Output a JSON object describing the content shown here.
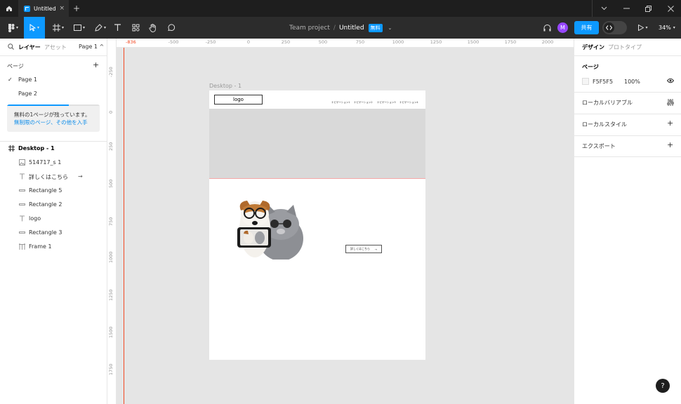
{
  "titlebar": {
    "tab_title": "Untitled",
    "tab_close": "×",
    "new_tab": "+"
  },
  "toolbar": {
    "breadcrumb_team": "Team project",
    "breadcrumb_sep": "/",
    "file_name": "Untitled",
    "plan_badge": "無料",
    "avatar_letter": "M",
    "share_label": "共有",
    "zoom_level": "34%"
  },
  "left_panel": {
    "tab_layers": "レイヤー",
    "tab_assets": "アセット",
    "page_selector": "Page 1 ^",
    "pages_title": "ページ",
    "pages": [
      "Page 1",
      "Page 2"
    ],
    "notice_line1": "無料の1ページが残っています。",
    "notice_line2": "無制限のページ、その他を入手",
    "notice_progress": 0.67,
    "layers": [
      {
        "name": "Desktop - 1",
        "icon": "frame-hash-icon"
      },
      {
        "name": "514717_s 1",
        "icon": "image-icon"
      },
      {
        "name": "詳しくはこちら",
        "icon": "text-icon",
        "trailing": "→"
      },
      {
        "name": "Rectangle 5",
        "icon": "rectangle-line-icon"
      },
      {
        "name": "Rectangle 2",
        "icon": "rectangle-line-icon"
      },
      {
        "name": "logo",
        "icon": "text-icon"
      },
      {
        "name": "Rectangle 3",
        "icon": "rectangle-line-icon"
      },
      {
        "name": "Frame 1",
        "icon": "frame-columns-icon"
      }
    ]
  },
  "canvas": {
    "ruler_x": [
      "-836",
      "-500",
      "-250",
      "0",
      "250",
      "500",
      "750",
      "1000",
      "1250",
      "1500",
      "1750",
      "2000"
    ],
    "ruler_y": [
      "-250",
      "0",
      "250",
      "500",
      "750",
      "1000",
      "1250",
      "1500",
      "1750"
    ],
    "frame_label": "Desktop - 1",
    "artboard": {
      "logo": "logo",
      "nav": [
        "ナビゲーション1",
        "ナビゲーション2",
        "ナビゲーション3",
        "ナビゲーション4"
      ],
      "button_label": "詳しくはこちら",
      "button_arrow": "→"
    }
  },
  "right_panel": {
    "tab_design": "デザイン",
    "tab_prototype": "プロトタイプ",
    "page_section": "ページ",
    "bg_hex": "F5F5F5",
    "bg_opacity": "100%",
    "local_variables": "ローカルバリアブル",
    "local_styles": "ローカルスタイル",
    "export": "エクスポート"
  },
  "help_label": "?"
}
